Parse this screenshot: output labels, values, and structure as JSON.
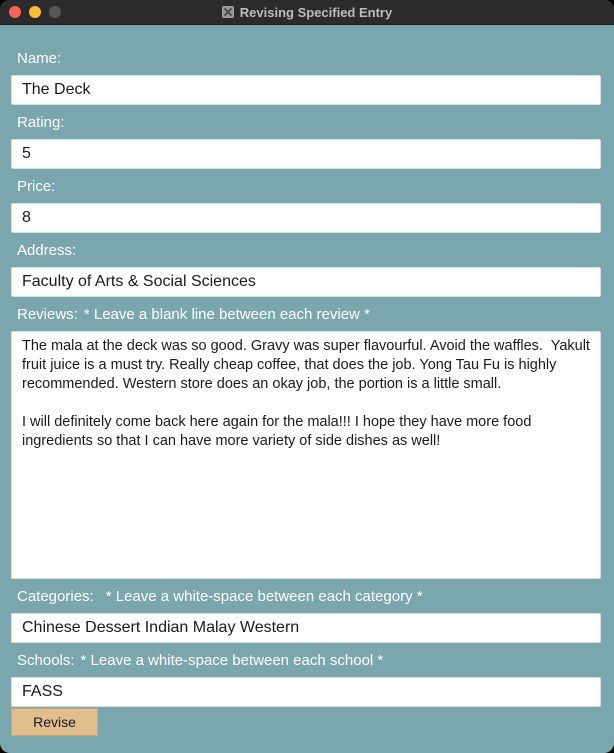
{
  "window": {
    "title": "Revising Specified Entry"
  },
  "form": {
    "name_label": "Name:",
    "name_value": "The Deck",
    "rating_label": "Rating:",
    "rating_value": "5",
    "price_label": "Price:",
    "price_value": "8",
    "address_label": "Address:",
    "address_value": "Faculty of Arts & Social Sciences",
    "reviews_label": "Reviews:",
    "reviews_hint": "* Leave a blank line between each review *",
    "reviews_value": "The mala at the deck was so good. Gravy was super flavourful. Avoid the waffles.  Yakult fruit juice is a must try. Really cheap coffee, that does the job. Yong Tau Fu is highly recommended. Western store does an okay job, the portion is a little small.\n\nI will definitely come back here again for the mala!!! I hope they have more food ingredients so that I can have more variety of side dishes as well!",
    "categories_label": "Categories:",
    "categories_hint": "* Leave a white-space between each category *",
    "categories_value": "Chinese Dessert Indian Malay Western",
    "schools_label": "Schools:",
    "schools_hint": "* Leave a white-space between each school *",
    "schools_value": "FASS",
    "revise_label": "Revise"
  },
  "colors": {
    "window_bg": "#7aa7ae",
    "button_bg": "#e2be8e",
    "titlebar_bg": "#2b2b2b"
  }
}
